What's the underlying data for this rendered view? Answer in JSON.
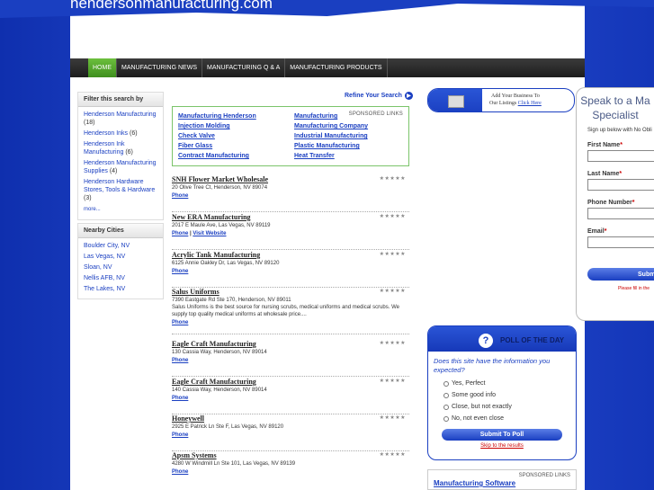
{
  "site": {
    "title": "hendersonmanufacturing.com"
  },
  "nav": [
    {
      "label": "HOME"
    },
    {
      "label": "MANUFACTURING NEWS"
    },
    {
      "label": "MANUFACTURING Q & A"
    },
    {
      "label": "MANUFACTURING PRODUCTS"
    }
  ],
  "filter": {
    "title": "Filter this search by",
    "items": [
      {
        "name": "Henderson Manufacturing",
        "count": "(18)"
      },
      {
        "name": "Henderson Inks",
        "count": "(6)"
      },
      {
        "name": "Henderson Ink Manufacturing",
        "count": "(6)"
      },
      {
        "name": "Henderson Manufacturing Supplies",
        "count": "(4)"
      },
      {
        "name": "Henderson Hardware Stores, Tools & Hardware",
        "count": "(3)"
      }
    ],
    "more": "more..."
  },
  "nearby": {
    "title": "Nearby Cities",
    "items": [
      "Boulder City, NV",
      "Las Vegas, NV",
      "Sloan, NV",
      "Nellis AFB, NV",
      "The Lakes, NV"
    ]
  },
  "refine": {
    "label": "Refine Your Search"
  },
  "sponsored": {
    "label": "SPONSORED LINKS",
    "left": [
      "Manufacturing Henderson",
      "Injection Molding",
      "Check Valve",
      "Fiber Glass",
      "Contract Manufacturing"
    ],
    "right": [
      "Manufacturing",
      "Manufacturing Company",
      "Industrial Manufacturing",
      "Plastic Manufacturing",
      "Heat Transfer"
    ]
  },
  "listings": [
    {
      "title": "SNH Flower Market Wholesale",
      "address": "20 Olive Tree Ct, Henderson, NV 89074",
      "phone": "Phone",
      "website": "",
      "desc": ""
    },
    {
      "title": "New ERA Manufacturing",
      "address": "2017 E Maule Ave, Las Vegas, NV 89119",
      "phone": "Phone",
      "website": "Visit Website",
      "desc": ""
    },
    {
      "title": "Acrylic Tank Manufacturing",
      "address": "6125 Annie Oakley Dr, Las Vegas, NV 89120",
      "phone": "Phone",
      "website": "",
      "desc": ""
    },
    {
      "title": "Salus Uniforms",
      "address": "7390 Eastgate Rd Ste 170, Henderson, NV 89011",
      "phone": "Phone",
      "website": "",
      "desc": "Salus Uniforms is the best source for nursing scrubs, medical uniforms and medical scrubs. We supply top quality medical uniforms at wholesale price...."
    },
    {
      "title": "Eagle Craft Manufacturing",
      "address": "130 Cassia Way, Henderson, NV 89014",
      "phone": "Phone",
      "website": "",
      "desc": ""
    },
    {
      "title": "Eagle Craft Manufacturing",
      "address": "140 Cassia Way, Henderson, NV 89014",
      "phone": "Phone",
      "website": "",
      "desc": ""
    },
    {
      "title": "Honeywell",
      "address": "2925 E Patrick Ln Ste F, Las Vegas, NV 89120",
      "phone": "Phone",
      "website": "",
      "desc": ""
    },
    {
      "title": "Apsm Systems",
      "address": "4280 W Windmill Ln Ste 101, Las Vegas, NV 89139",
      "phone": "Phone",
      "website": "",
      "desc": ""
    }
  ],
  "stars": "★★★★★",
  "add_business": {
    "line1": "Add Your Business To",
    "line2": "Our Listings",
    "link": "Click Here"
  },
  "poll": {
    "title": "POLL OF THE DAY",
    "question": "Does this site have the information you expected?",
    "options": [
      "Yes, Perfect",
      "Some good info",
      "Close, but not exactly",
      "No, not even close"
    ],
    "submit": "Submit To Poll",
    "skip": "Skip to the results"
  },
  "sponsored_right": {
    "label": "SPONSORED LINKS",
    "title": "Manufacturing Software"
  },
  "speak": {
    "title_line1": "Speak to a Ma",
    "title_line2": "Specialist",
    "subtitle": "Sign up below with No Obli",
    "first_name": "First Name",
    "last_name": "Last Name",
    "phone": "Phone Number",
    "email": "Email",
    "required_mark": "*",
    "submit": "Subm",
    "note": "Please fill in the"
  }
}
